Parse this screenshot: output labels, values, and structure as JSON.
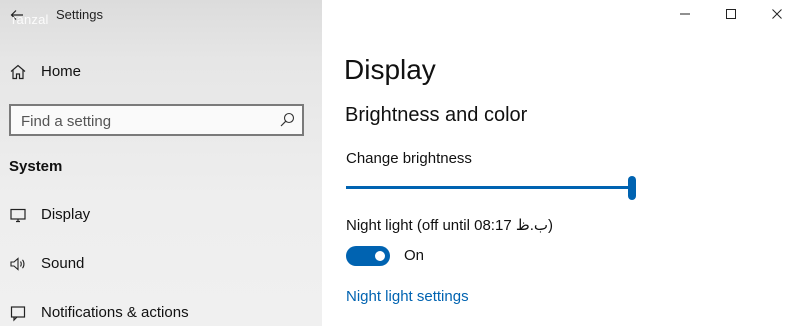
{
  "window": {
    "title": "Settings",
    "watermark": "ranzal"
  },
  "sidebar": {
    "home_label": "Home",
    "search": {
      "placeholder": "Find a setting",
      "value": ""
    },
    "section_header": "System",
    "items": [
      {
        "label": "Display",
        "icon": "monitor-icon"
      },
      {
        "label": "Sound",
        "icon": "speaker-icon"
      },
      {
        "label": "Notifications & actions",
        "icon": "notification-icon"
      }
    ]
  },
  "main": {
    "page_title": "Display",
    "subheading": "Brightness and color",
    "brightness": {
      "label": "Change brightness",
      "value_percent": 100
    },
    "night_light": {
      "label": "Night light (off until 08:17 ب.ظ)",
      "toggle_on": true,
      "toggle_state_label": "On",
      "settings_link": "Night light settings"
    }
  },
  "colors": {
    "accent": "#0063b1",
    "sidebar_bg": "#eeeeee",
    "main_bg": "#ffffff"
  }
}
